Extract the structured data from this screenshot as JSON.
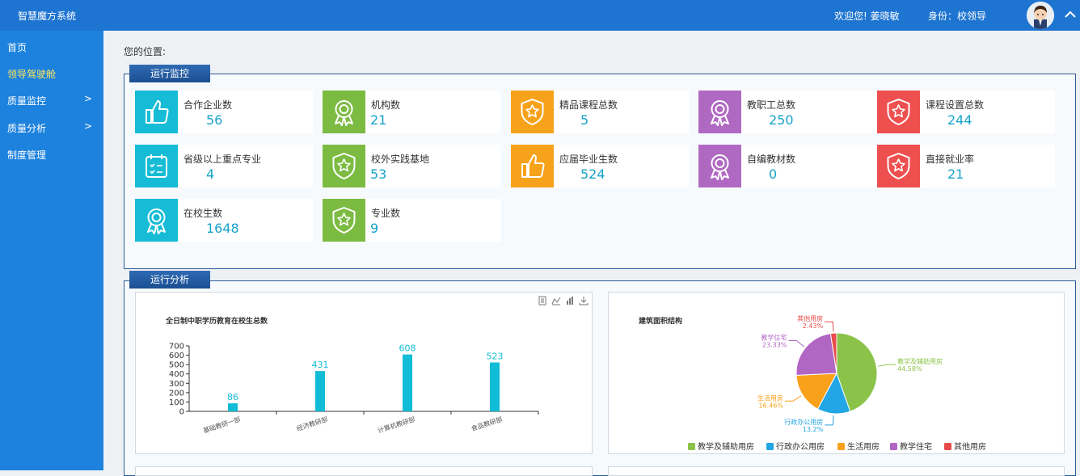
{
  "header": {
    "app_title": "智慧魔方系统",
    "welcome": "欢迎您! 姜晓敏",
    "identity": "身份：校领导"
  },
  "sidebar": {
    "items": [
      {
        "label": "首页",
        "arrow": ""
      },
      {
        "label": "领导驾驶舱",
        "arrow": "",
        "active": true
      },
      {
        "label": "质量监控",
        "arrow": ">"
      },
      {
        "label": "质量分析",
        "arrow": ">"
      },
      {
        "label": "制度管理",
        "arrow": ""
      }
    ]
  },
  "breadcrumb": "您的位置:",
  "monitor": {
    "title": "运行监控",
    "cards": [
      {
        "label": "合作企业数",
        "value": "56",
        "icon": "thumbs-up-icon",
        "color": "#16bcd6"
      },
      {
        "label": "机构数",
        "value": "21",
        "icon": "award-medal-icon",
        "color": "#7cbb42"
      },
      {
        "label": "精品课程总数",
        "value": "5",
        "icon": "shield-star-icon",
        "color": "#f7a21b"
      },
      {
        "label": "教职工总数",
        "value": "250",
        "icon": "award-medal-icon",
        "color": "#b069c2"
      },
      {
        "label": "课程设置总数",
        "value": "244",
        "icon": "shield-star-icon",
        "color": "#ee4f4f"
      },
      {
        "label": "省级以上重点专业",
        "value": "4",
        "icon": "calendar-icon",
        "color": "#16bcd6"
      },
      {
        "label": "校外实践基地",
        "value": "53",
        "icon": "shield-star-icon",
        "color": "#7cbb42"
      },
      {
        "label": "应届毕业生数",
        "value": "524",
        "icon": "thumbs-up-icon",
        "color": "#f7a21b"
      },
      {
        "label": "自编教材数",
        "value": "0",
        "icon": "award-medal-icon",
        "color": "#b069c2"
      },
      {
        "label": "直接就业率",
        "value": "21",
        "icon": "shield-star-icon",
        "color": "#ee4f4f"
      },
      {
        "label": "在校生数",
        "value": "1648",
        "icon": "award-medal-icon",
        "color": "#16bcd6"
      },
      {
        "label": "专业数",
        "value": "9",
        "icon": "shield-star-icon",
        "color": "#7cbb42"
      }
    ]
  },
  "analysis": {
    "title": "运行分析"
  },
  "chart_data": [
    {
      "type": "bar",
      "title": "全日制中职学历教育在校生总数",
      "categories": [
        "基础教研一部",
        "经济教研部",
        "计算机教研部",
        "食品教研部"
      ],
      "values": [
        86,
        431,
        608,
        523
      ],
      "yticks": [
        "0",
        "100",
        "200",
        "300",
        "400",
        "500",
        "600",
        "700"
      ],
      "ylim": [
        0,
        700
      ],
      "color": "#11bcd6",
      "legend": "none"
    },
    {
      "type": "pie",
      "title": "建筑面积结构",
      "slices": [
        {
          "name": "教学及辅助用房",
          "value": 44.58,
          "label": "44.58%",
          "color": "#8bc34a"
        },
        {
          "name": "行政办公用房",
          "value": 13.2,
          "label": "13.2%",
          "color": "#23a6e5"
        },
        {
          "name": "生活用房",
          "value": 16.46,
          "label": "16.46%",
          "color": "#f9a11b"
        },
        {
          "name": "教学住宅",
          "value": 23.33,
          "label": "23.33%",
          "color": "#b266c4"
        },
        {
          "name": "其他用房",
          "value": 2.43,
          "label": "2.43%",
          "color": "#e94b4b"
        }
      ],
      "legend": "bottom"
    }
  ]
}
